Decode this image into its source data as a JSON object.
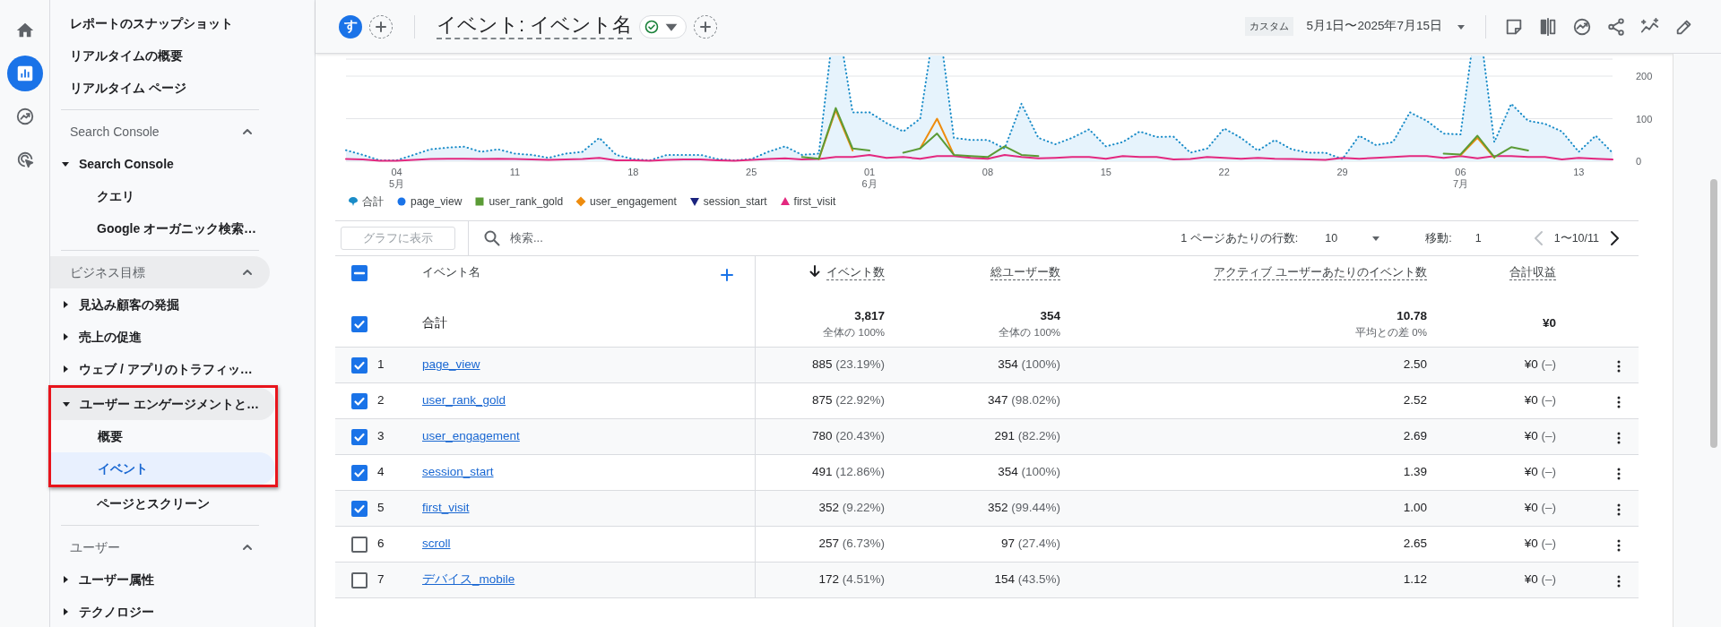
{
  "rail": [
    {
      "selected": false
    },
    {
      "selected": true
    },
    {
      "selected": false
    },
    {
      "selected": false
    }
  ],
  "sidebar": {
    "top_items": [
      {
        "label": "レポートのスナップショット",
        "selected": false
      },
      {
        "label": "リアルタイムの概要",
        "selected": false
      },
      {
        "label": "リアルタイム ページ",
        "selected": false
      }
    ],
    "sections": [
      {
        "title": "Search Console",
        "expanded": true,
        "hovered": false,
        "items": [
          {
            "label": "Search Console",
            "expanded": true,
            "selected": false,
            "highlighted": false,
            "children": [
              {
                "label": "クエリ",
                "selected": false,
                "highlighted": false
              },
              {
                "label": "Google オーガニック検索…",
                "selected": false,
                "highlighted": false
              }
            ]
          }
        ]
      },
      {
        "title": "ビジネス目標",
        "expanded": true,
        "hovered": true,
        "items": [
          {
            "label": "見込み顧客の発掘",
            "expanded": false,
            "selected": false,
            "highlighted": false
          },
          {
            "label": "売上の促進",
            "expanded": false,
            "selected": false,
            "highlighted": false
          },
          {
            "label": "ウェブ / アプリのトラフィッ…",
            "expanded": false,
            "selected": false,
            "highlighted": false
          },
          {
            "label": "ユーザー エンゲージメントと…",
            "expanded": true,
            "selected": false,
            "highlighted": true,
            "children": [
              {
                "label": "概要",
                "selected": false,
                "highlighted": true
              },
              {
                "label": "イベント",
                "selected": true,
                "highlighted": true
              },
              {
                "label": "ページとスクリーン",
                "selected": false,
                "highlighted": false
              }
            ]
          }
        ]
      },
      {
        "title": "ユーザー",
        "expanded": true,
        "hovered": false,
        "items": [
          {
            "label": "ユーザー属性",
            "expanded": false,
            "selected": false,
            "highlighted": false
          },
          {
            "label": "テクノロジー",
            "expanded": false,
            "selected": false,
            "highlighted": false
          }
        ]
      }
    ]
  },
  "header": {
    "avatar": "す",
    "title": "イベント: イベント名",
    "verified": true,
    "date_label": "カスタム",
    "date_range": "5月1日〜2025年7月15日",
    "tools": [
      {
        "kind": "note"
      },
      {
        "kind": "compare"
      },
      {
        "kind": "insights"
      },
      {
        "kind": "share"
      },
      {
        "kind": "trend"
      },
      {
        "kind": "edit"
      }
    ]
  },
  "chart": {
    "chart_data": {
      "type": "line",
      "x": [
        "2025-05-01",
        "2025-05-02",
        "2025-05-03",
        "2025-05-04",
        "2025-05-05",
        "2025-05-06",
        "2025-05-07",
        "2025-05-08",
        "2025-05-09",
        "2025-05-10",
        "2025-05-11",
        "2025-05-12",
        "2025-05-13",
        "2025-05-14",
        "2025-05-15",
        "2025-05-16",
        "2025-05-17",
        "2025-05-18",
        "2025-05-19",
        "2025-05-20",
        "2025-05-21",
        "2025-05-22",
        "2025-05-23",
        "2025-05-24",
        "2025-05-25",
        "2025-05-26",
        "2025-05-27",
        "2025-05-28",
        "2025-05-29",
        "2025-05-30",
        "2025-05-31",
        "2025-06-01",
        "2025-06-02",
        "2025-06-03",
        "2025-06-04",
        "2025-06-05",
        "2025-06-06",
        "2025-06-07",
        "2025-06-08",
        "2025-06-09",
        "2025-06-10",
        "2025-06-11",
        "2025-06-12",
        "2025-06-13",
        "2025-06-14",
        "2025-06-15",
        "2025-06-16",
        "2025-06-17",
        "2025-06-18",
        "2025-06-19",
        "2025-06-20",
        "2025-06-21",
        "2025-06-22",
        "2025-06-23",
        "2025-06-24",
        "2025-06-25",
        "2025-06-26",
        "2025-06-27",
        "2025-06-28",
        "2025-06-29",
        "2025-06-30",
        "2025-07-01",
        "2025-07-02",
        "2025-07-03",
        "2025-07-04",
        "2025-07-05",
        "2025-07-06",
        "2025-07-07",
        "2025-07-08",
        "2025-07-09",
        "2025-07-10",
        "2025-07-11",
        "2025-07-12",
        "2025-07-13",
        "2025-07-14",
        "2025-07-15"
      ],
      "series": [
        {
          "name": "合計",
          "color": "#1a8cc8",
          "line_style": "dotted",
          "values": [
            26,
            15,
            2,
            2,
            15,
            28,
            32,
            34,
            22,
            28,
            18,
            15,
            8,
            18,
            22,
            55,
            15,
            5,
            2,
            15,
            15,
            15,
            5,
            2,
            5,
            22,
            35,
            15,
            18,
            null,
            115,
            115,
            90,
            70,
            100,
            null,
            55,
            50,
            50,
            30,
            135,
            55,
            40,
            55,
            75,
            35,
            45,
            70,
            57,
            58,
            20,
            30,
            77,
            55,
            25,
            50,
            28,
            20,
            20,
            5,
            60,
            38,
            45,
            115,
            95,
            65,
            63,
            null,
            45,
            135,
            95,
            88,
            70,
            22,
            60,
            20
          ]
        },
        {
          "name": "page_view",
          "color": "#1a73e8",
          "values": [
            null,
            null,
            null,
            null,
            null,
            null,
            null,
            null,
            null,
            null,
            null,
            null,
            null,
            null,
            null,
            null,
            null,
            null,
            null,
            null,
            null,
            null,
            null,
            null,
            null,
            null,
            null,
            null,
            null,
            null,
            null,
            null,
            null,
            null,
            null,
            null,
            null,
            null,
            null,
            null,
            null,
            null,
            null,
            null,
            null,
            null,
            null,
            null,
            null,
            null,
            null,
            null,
            null,
            null,
            null,
            null,
            null,
            null,
            null,
            null,
            null,
            null,
            null,
            null,
            null,
            null,
            null,
            null,
            null,
            null,
            null,
            null,
            null,
            null,
            null,
            null
          ]
        },
        {
          "name": "user_rank_gold",
          "color": "#5b9b36",
          "values": [
            null,
            null,
            null,
            null,
            null,
            null,
            null,
            null,
            null,
            null,
            null,
            null,
            null,
            null,
            null,
            null,
            null,
            null,
            null,
            null,
            null,
            null,
            null,
            null,
            null,
            null,
            null,
            10,
            6,
            125,
            30,
            25,
            null,
            20,
            30,
            65,
            15,
            12,
            10,
            35,
            15,
            12,
            null,
            null,
            null,
            null,
            null,
            null,
            null,
            null,
            null,
            null,
            null,
            null,
            null,
            null,
            null,
            null,
            null,
            null,
            null,
            null,
            null,
            null,
            null,
            18,
            16,
            60,
            10,
            33,
            25,
            null,
            null,
            null,
            null,
            null
          ]
        },
        {
          "name": "user_engagement",
          "color": "#ee8c0e",
          "values": [
            null,
            null,
            null,
            null,
            null,
            null,
            null,
            null,
            null,
            null,
            null,
            null,
            null,
            null,
            null,
            null,
            null,
            null,
            null,
            null,
            null,
            null,
            null,
            null,
            null,
            null,
            null,
            null,
            5,
            120,
            25,
            null,
            null,
            null,
            30,
            100,
            15,
            null,
            null,
            null,
            null,
            null,
            null,
            null,
            null,
            null,
            null,
            null,
            null,
            null,
            null,
            null,
            null,
            null,
            null,
            null,
            null,
            null,
            null,
            null,
            null,
            null,
            null,
            null,
            null,
            null,
            14,
            55,
            8,
            null,
            null,
            null,
            null,
            null,
            null,
            null
          ]
        },
        {
          "name": "session_start",
          "color": "#1a237e",
          "values": [
            null,
            null,
            null,
            null,
            null,
            null,
            null,
            null,
            null,
            null,
            null,
            null,
            null,
            null,
            null,
            null,
            null,
            null,
            null,
            null,
            null,
            null,
            null,
            null,
            null,
            null,
            null,
            null,
            null,
            null,
            null,
            null,
            null,
            null,
            null,
            null,
            null,
            null,
            null,
            null,
            null,
            null,
            null,
            null,
            null,
            null,
            null,
            null,
            null,
            null,
            null,
            null,
            null,
            null,
            null,
            null,
            null,
            null,
            null,
            null,
            null,
            null,
            null,
            null,
            null,
            null,
            null,
            null,
            null,
            null,
            null,
            null,
            null,
            null,
            null,
            null
          ]
        },
        {
          "name": "first_visit",
          "color": "#e3287f",
          "values": [
            5,
            4,
            1,
            1,
            3,
            5,
            6,
            6,
            5,
            6,
            5,
            4,
            3,
            4,
            5,
            8,
            2,
            2,
            1,
            3,
            4,
            4,
            2,
            1,
            3,
            5,
            7,
            4,
            5,
            10,
            10,
            15,
            8,
            10,
            6,
            12,
            12,
            8,
            6,
            15,
            10,
            7,
            8,
            10,
            10,
            6,
            12,
            10,
            10,
            4,
            5,
            10,
            8,
            6,
            8,
            6,
            5,
            4,
            3,
            8,
            6,
            8,
            10,
            12,
            12,
            8,
            12,
            7,
            12,
            12,
            10,
            10,
            4,
            8,
            6,
            4
          ]
        }
      ],
      "xlim": [
        "2025-05-01",
        "2025-07-15"
      ],
      "ylim": [
        0,
        240
      ],
      "yticks": [
        0,
        100,
        200
      ],
      "xticks": [
        {
          "value": "2025-05-04",
          "label": "04"
        },
        {
          "value": "2025-05-11",
          "label": "11"
        },
        {
          "value": "2025-05-18",
          "label": "18"
        },
        {
          "value": "2025-05-25",
          "label": "25"
        },
        {
          "value": "2025-06-01",
          "label": "01"
        },
        {
          "value": "2025-06-08",
          "label": "08"
        },
        {
          "value": "2025-06-15",
          "label": "15"
        },
        {
          "value": "2025-06-22",
          "label": "22"
        },
        {
          "value": "2025-06-29",
          "label": "29"
        },
        {
          "value": "2025-07-06",
          "label": "06"
        },
        {
          "value": "2025-07-13",
          "label": "13"
        }
      ],
      "annotations": [
        "5月",
        "6月",
        "7月"
      ]
    }
  },
  "toolbar": {
    "chart_button": "グラフに表示",
    "chart_button_disabled": true,
    "search_placeholder": "検索...",
    "rows_label": "1 ページあたりの行数:",
    "rows_value": "10",
    "goto_label": "移動:",
    "goto_value": "1",
    "range": "1〜10/11",
    "prev_disabled": true,
    "next_disabled": false
  },
  "table": {
    "select_all_indeterminate": true,
    "dimension_column": {
      "label": "イベント名"
    },
    "columns": [
      {
        "label": "イベント数",
        "sorted": true
      },
      {
        "label": "総ユーザー数",
        "sorted": false
      },
      {
        "label": "アクティブ ユーザーあたりのイベント数",
        "sorted": false
      },
      {
        "label": "合計収益",
        "sorted": false
      }
    ],
    "totals": {
      "checked": true,
      "label": "合計",
      "cells": [
        {
          "value": "3,817",
          "note": "全体の 100%"
        },
        {
          "value": "354",
          "note": "全体の 100%"
        },
        {
          "value": "10.78",
          "note": "平均との差 0%"
        },
        {
          "value": "¥0"
        }
      ]
    },
    "rows": [
      {
        "checked": true,
        "index": "1",
        "name": "page_view",
        "cells": [
          {
            "value": "885",
            "share": "(23.19%)"
          },
          {
            "value": "354",
            "share": "(100%)"
          },
          {
            "value": "2.50"
          },
          {
            "value": "¥0",
            "share": "(–)"
          }
        ]
      },
      {
        "checked": true,
        "index": "2",
        "name": "user_rank_gold",
        "cells": [
          {
            "value": "875",
            "share": "(22.92%)"
          },
          {
            "value": "347",
            "share": "(98.02%)"
          },
          {
            "value": "2.52"
          },
          {
            "value": "¥0",
            "share": "(–)"
          }
        ]
      },
      {
        "checked": true,
        "index": "3",
        "name": "user_engagement",
        "cells": [
          {
            "value": "780",
            "share": "(20.43%)"
          },
          {
            "value": "291",
            "share": "(82.2%)"
          },
          {
            "value": "2.69"
          },
          {
            "value": "¥0",
            "share": "(–)"
          }
        ]
      },
      {
        "checked": true,
        "index": "4",
        "name": "session_start",
        "cells": [
          {
            "value": "491",
            "share": "(12.86%)"
          },
          {
            "value": "354",
            "share": "(100%)"
          },
          {
            "value": "1.39"
          },
          {
            "value": "¥0",
            "share": "(–)"
          }
        ]
      },
      {
        "checked": true,
        "index": "5",
        "name": "first_visit",
        "cells": [
          {
            "value": "352",
            "share": "(9.22%)"
          },
          {
            "value": "352",
            "share": "(99.44%)"
          },
          {
            "value": "1.00"
          },
          {
            "value": "¥0",
            "share": "(–)"
          }
        ]
      },
      {
        "checked": false,
        "index": "6",
        "name": "scroll",
        "cells": [
          {
            "value": "257",
            "share": "(6.73%)"
          },
          {
            "value": "97",
            "share": "(27.4%)"
          },
          {
            "value": "2.65"
          },
          {
            "value": "¥0",
            "share": "(–)"
          }
        ]
      },
      {
        "checked": false,
        "index": "7",
        "name": "デバイス_mobile",
        "cells": [
          {
            "value": "172",
            "share": "(4.51%)"
          },
          {
            "value": "154",
            "share": "(43.5%)"
          },
          {
            "value": "1.12"
          },
          {
            "value": "¥0",
            "share": "(–)"
          }
        ]
      }
    ]
  }
}
